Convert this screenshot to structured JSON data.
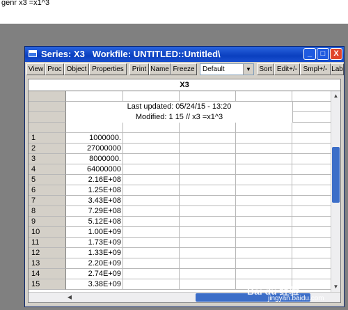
{
  "command_line": "genr x3 =x1^3",
  "window": {
    "title": "Series: X3   Workfile: UNTITLED::Untitled\\",
    "controls": {
      "minimize": "_",
      "maximize": "□",
      "close": "X"
    }
  },
  "toolbar": {
    "buttons": [
      "View",
      "Proc",
      "Object",
      "Properties",
      "Print",
      "Name",
      "Freeze"
    ],
    "select_value": "Default",
    "right_buttons": [
      "Sort",
      "Edit+/-",
      "Smpl+/-",
      "Lab"
    ]
  },
  "sheet": {
    "series_name": "X3",
    "last_updated": "Last updated: 05/24/15 - 13:20",
    "modified": "Modified: 1 15 // x3 =x1^3",
    "rows": [
      {
        "obs": "1",
        "value": "1000000."
      },
      {
        "obs": "2",
        "value": "27000000"
      },
      {
        "obs": "3",
        "value": "8000000."
      },
      {
        "obs": "4",
        "value": "64000000"
      },
      {
        "obs": "5",
        "value": "2.16E+08"
      },
      {
        "obs": "6",
        "value": "1.25E+08"
      },
      {
        "obs": "7",
        "value": "3.43E+08"
      },
      {
        "obs": "8",
        "value": "7.29E+08"
      },
      {
        "obs": "9",
        "value": "5.12E+08"
      },
      {
        "obs": "10",
        "value": "1.00E+09"
      },
      {
        "obs": "11",
        "value": "1.73E+09"
      },
      {
        "obs": "12",
        "value": "1.33E+09"
      },
      {
        "obs": "13",
        "value": "2.20E+09"
      },
      {
        "obs": "14",
        "value": "2.74E+09"
      },
      {
        "obs": "15",
        "value": "3.38E+09"
      }
    ]
  },
  "watermark": {
    "logo": "Bai du 经验",
    "url": "jingyan.baidu.com"
  }
}
